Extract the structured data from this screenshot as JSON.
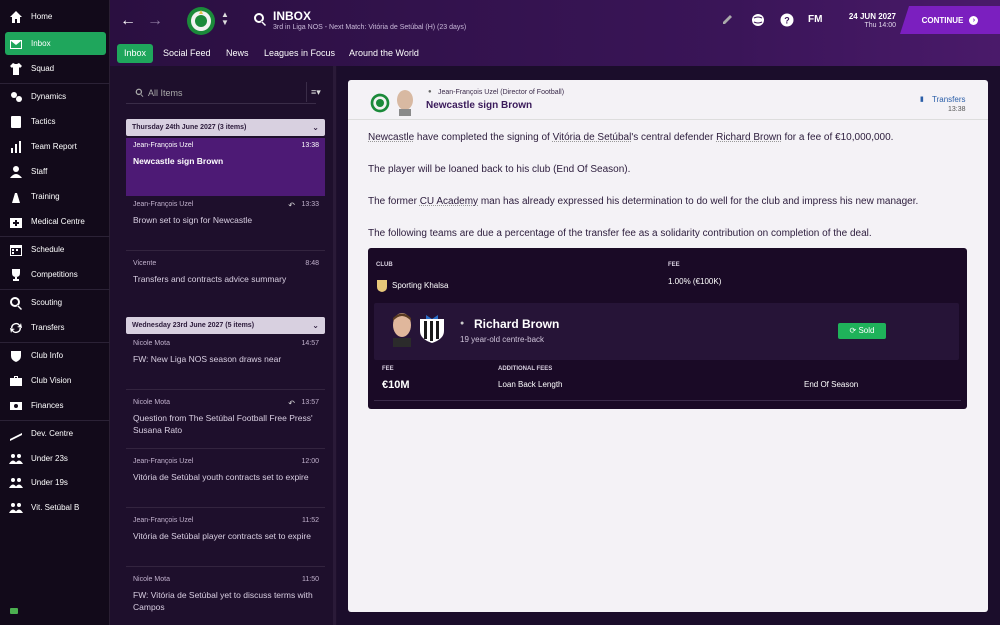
{
  "sidebar": {
    "items": [
      {
        "label": "Home",
        "icon": "home-icon"
      },
      {
        "label": "Inbox",
        "icon": "inbox-icon",
        "active": true
      },
      {
        "label": "Squad",
        "icon": "shirt-icon"
      },
      {
        "label": "Dynamics",
        "icon": "dynamics-icon"
      },
      {
        "label": "Tactics",
        "icon": "tactics-icon"
      },
      {
        "label": "Team Report",
        "icon": "report-icon"
      },
      {
        "label": "Staff",
        "icon": "staff-icon"
      },
      {
        "label": "Training",
        "icon": "training-icon"
      },
      {
        "label": "Medical Centre",
        "icon": "medical-icon"
      },
      {
        "label": "Schedule",
        "icon": "calendar-icon"
      },
      {
        "label": "Competitions",
        "icon": "trophy-icon"
      },
      {
        "label": "Scouting",
        "icon": "magnifier-icon"
      },
      {
        "label": "Transfers",
        "icon": "transfers-icon"
      },
      {
        "label": "Club Info",
        "icon": "shield-icon"
      },
      {
        "label": "Club Vision",
        "icon": "briefcase-icon"
      },
      {
        "label": "Finances",
        "icon": "money-icon"
      },
      {
        "label": "Dev. Centre",
        "icon": "development-icon"
      },
      {
        "label": "Under 23s",
        "icon": "people-icon"
      },
      {
        "label": "Under 19s",
        "icon": "people-icon"
      },
      {
        "label": "Vit. Setúbal B",
        "icon": "people-icon"
      }
    ]
  },
  "header": {
    "title": "INBOX",
    "subtitle": "3rd in Liga NOS - Next Match: Vitória de Setúbal (H) (23 days)",
    "date": "24 JUN 2027",
    "time": "Thu 14:00",
    "logo": "FM",
    "continue_label": "CONTINUE"
  },
  "tabs": [
    "Inbox",
    "Social Feed",
    "News",
    "Leagues in Focus",
    "Around the World"
  ],
  "list": {
    "filter_placeholder": "All Items",
    "groups": [
      {
        "title": "Thursday 24th June 2027 (3 items)"
      },
      {
        "title": "Wednesday 23rd June 2027 (5 items)"
      }
    ],
    "messages": [
      {
        "from": "Jean-François Uzel",
        "time": "13:38",
        "subject": "Newcastle sign Brown",
        "active": true
      },
      {
        "from": "Jean-François Uzel",
        "time": "13:33",
        "subject": "Brown set to sign for Newcastle",
        "reply": true
      },
      {
        "from": "Vicente",
        "time": "8:48",
        "subject": "Transfers and contracts advice summary"
      },
      {
        "from": "Nicole Mota",
        "time": "14:57",
        "subject": "FW: New Liga NOS season draws near"
      },
      {
        "from": "Nicole Mota",
        "time": "13:57",
        "subject": "Question from The Setúbal Football Free Press' Susana Rato",
        "reply": true
      },
      {
        "from": "Jean-François Uzel",
        "time": "12:00",
        "subject": "Vitória de Setúbal youth contracts set to expire"
      },
      {
        "from": "Jean-François Uzel",
        "time": "11:52",
        "subject": "Vitória de Setúbal player contracts set to expire"
      },
      {
        "from": "Nicole Mota",
        "time": "11:50",
        "subject": "FW: Vitória de Setúbal yet to discuss terms with Campos"
      }
    ]
  },
  "message": {
    "from": "Jean-François Uzel  (Director of Football)",
    "subject": "Newcastle sign Brown",
    "category": "Transfers",
    "time": "13:38",
    "p1": {
      "a": "Newcastle",
      "b": " have completed the signing of ",
      "c": "Vitória de Setúbal",
      "d": "'s central defender ",
      "e": "Richard Brown",
      "f": " for a fee of €10,000,000."
    },
    "p2": "The player will be loaned back to his club (End Of Season).",
    "p3": {
      "a": "The former ",
      "b": "CU Academy",
      "c": " man has already expressed his determination to do well for the club and impress his new manager."
    },
    "p4": "The following teams are due a percentage of the transfer fee as a solidarity contribution on completion of the deal.",
    "solidarity": {
      "club_label": "CLUB",
      "fee_label": "FEE",
      "club": "Sporting Khalsa",
      "fee": "1.00% (€100K)"
    },
    "player": {
      "name": "Richard Brown",
      "desc": "19 year-old centre-back",
      "status": "Sold"
    },
    "deal": {
      "fee_label": "FEE",
      "fee": "€10M",
      "additional_label": "ADDITIONAL FEES",
      "additional_name": "Loan Back Length",
      "additional_value": "End Of Season"
    }
  },
  "colors": {
    "accent": "#1fa65c",
    "continue": "#7b1fbf",
    "active_message": "#4d1a75"
  }
}
